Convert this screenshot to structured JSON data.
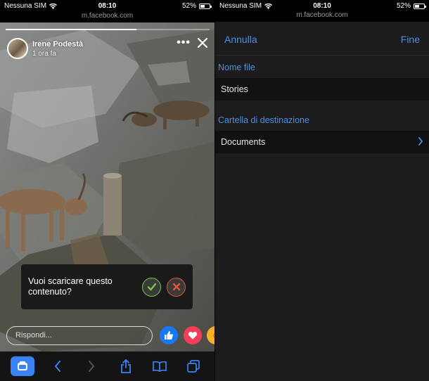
{
  "left": {
    "status": {
      "carrier": "Nessuna SIM",
      "time": "08:10",
      "battery": "52%",
      "battery_level": 0.52
    },
    "url": "m.facebook.com",
    "story": {
      "author": "Irene Podestà",
      "time": "1 ora fa",
      "more": "•••",
      "progress": 0.64
    },
    "dialog": {
      "question": "Vuoi scaricare questo contenuto?"
    },
    "reply_placeholder": "Rispondi...",
    "reactions": [
      "like-icon",
      "love-icon",
      "haha-icon"
    ],
    "toolbar": [
      "tabs-square-icon",
      "back-icon",
      "forward-icon",
      "share-icon",
      "bookmarks-icon",
      "tabs-icon"
    ]
  },
  "right": {
    "status": {
      "carrier": "Nessuna SIM",
      "time": "08:10",
      "battery": "52%",
      "battery_level": 0.52
    },
    "url": "m.facebook.com",
    "nav": {
      "cancel": "Annulla",
      "done": "Fine"
    },
    "filename_label": "Nome file",
    "filename_value": "Stories",
    "folder_label": "Cartella di destinazione",
    "folder_value": "Documents"
  },
  "colors": {
    "accent": "#4a90e2",
    "confirm": "#7ac943",
    "reject": "#e5533d",
    "active_tab": "#3b82f6"
  }
}
